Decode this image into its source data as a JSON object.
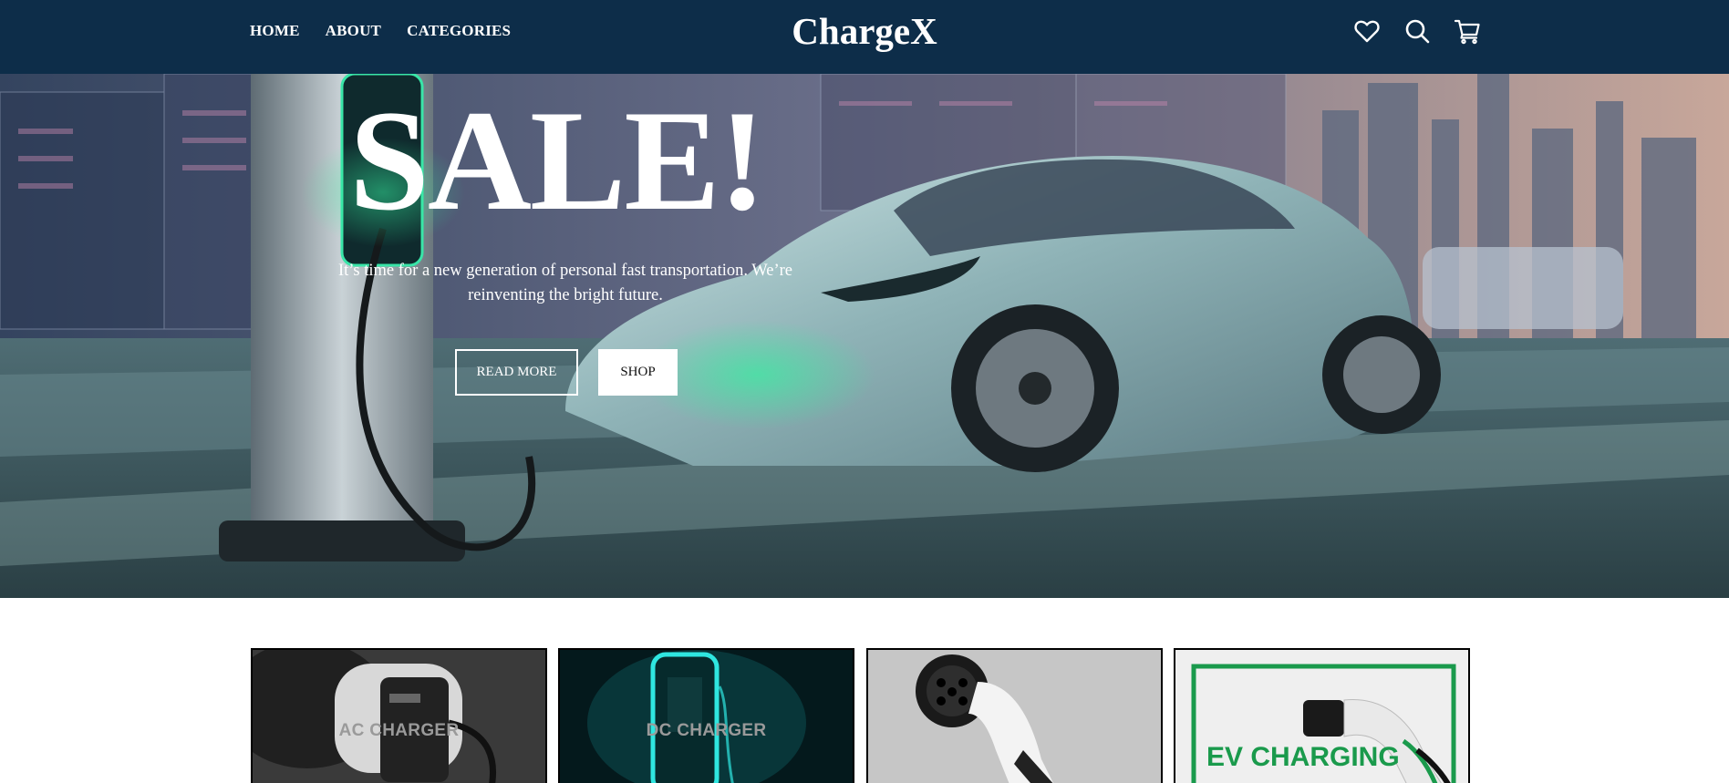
{
  "header": {
    "nav": [
      "HOME",
      "ABOUT",
      "CATEGORIES"
    ],
    "brand": "ChargeX",
    "icons": [
      "heart-icon",
      "search-icon",
      "cart-icon"
    ],
    "background": "#0d2d49"
  },
  "hero": {
    "title": "SALE!",
    "subtitle": "It’s time for a new generation of personal fast transportation. We’re reinventing the bright future.",
    "buttons": {
      "read_more": "READ MORE",
      "shop": "SHOP"
    }
  },
  "categories": {
    "items": [
      {
        "label": "AC CHARGER"
      },
      {
        "label": "DC CHARGER"
      },
      {
        "label": ""
      },
      {
        "label": "EV CHARGING"
      }
    ]
  }
}
